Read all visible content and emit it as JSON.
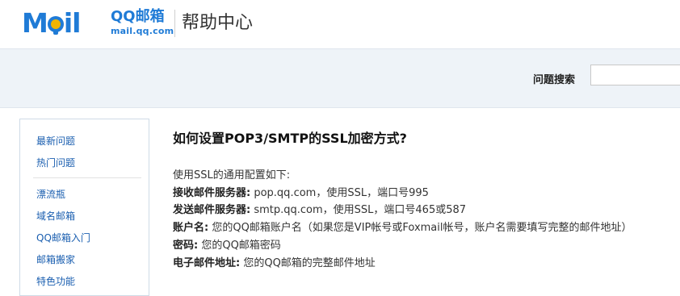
{
  "header": {
    "logo_text_1": "M",
    "logo_text_2": "il",
    "brand_name": "QQ邮箱",
    "brand_url": "mail.qq.com",
    "page_title": "帮助中心"
  },
  "search": {
    "label": "问题搜索",
    "placeholder": ""
  },
  "sidebar": {
    "items": [
      {
        "label": "最新问题"
      },
      {
        "label": "热门问题"
      },
      {
        "label": "漂流瓶"
      },
      {
        "label": "域名邮箱"
      },
      {
        "label": "QQ邮箱入门"
      },
      {
        "label": "邮箱搬家"
      },
      {
        "label": "特色功能"
      }
    ]
  },
  "article": {
    "title": "如何设置POP3/SMTP的SSL加密方式?",
    "intro": "使用SSL的通用配置如下:",
    "lines": [
      {
        "label": "接收邮件服务器:",
        "value": "pop.qq.com，使用SSL，端口号995"
      },
      {
        "label": "发送邮件服务器:",
        "value": "smtp.qq.com，使用SSL，端口号465或587"
      },
      {
        "label": "账户名:",
        "value": "您的QQ邮箱账户名（如果您是VIP帐号或Foxmail帐号，账户名需要填写完整的邮件地址）"
      },
      {
        "label": "密码:",
        "value": "您的QQ邮箱密码"
      },
      {
        "label": "电子邮件地址:",
        "value": "您的QQ邮箱的完整邮件地址"
      }
    ]
  },
  "colors": {
    "brand": "#1f7bd6",
    "link": "#1b5fb0",
    "band": "#eef3f8"
  }
}
